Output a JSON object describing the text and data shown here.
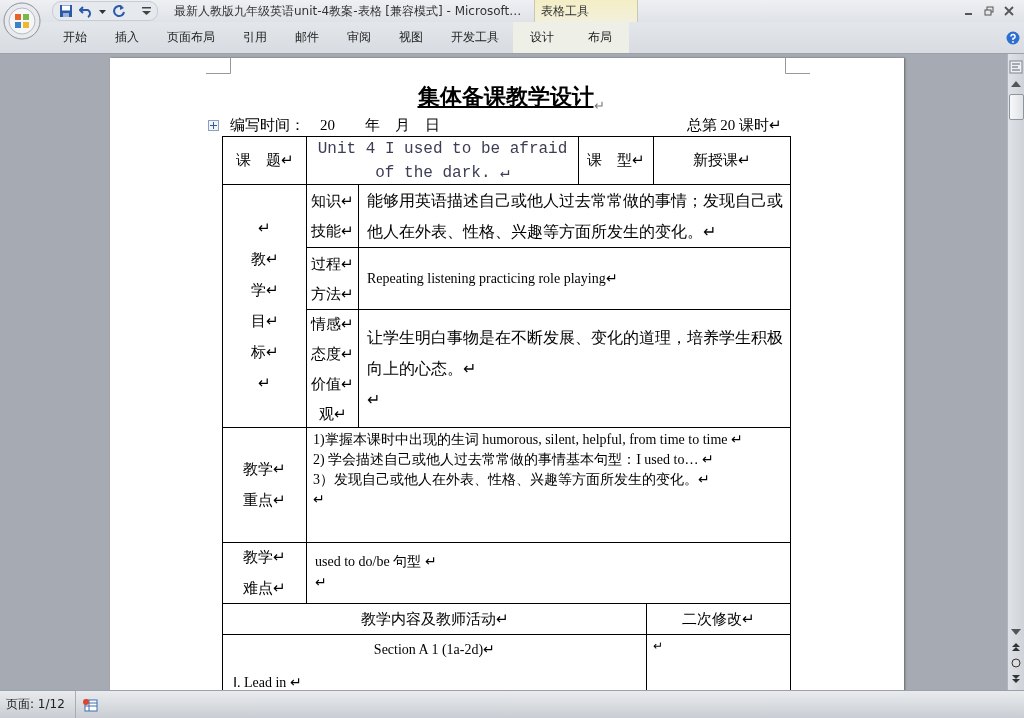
{
  "window": {
    "title": "最新人教版九年级英语unit-4教案-表格 [兼容模式] - Microsoft…",
    "context_group": "表格工具"
  },
  "ribbon_tabs": [
    {
      "label": "开始",
      "kind": "standard"
    },
    {
      "label": "插入",
      "kind": "standard"
    },
    {
      "label": "页面布局",
      "kind": "standard"
    },
    {
      "label": "引用",
      "kind": "standard"
    },
    {
      "label": "邮件",
      "kind": "standard"
    },
    {
      "label": "审阅",
      "kind": "standard"
    },
    {
      "label": "视图",
      "kind": "standard"
    },
    {
      "label": "开发工具",
      "kind": "standard"
    },
    {
      "label": "设计",
      "kind": "contextual"
    },
    {
      "label": "布局",
      "kind": "contextual"
    }
  ],
  "document": {
    "title": "集体备课教学设计",
    "title_mark": "↵",
    "meta_left": "编写时间：　20　　年　月　日",
    "meta_right": "总第 20 课时↵",
    "table": {
      "topic_label": "课　题↵",
      "topic": "Unit 4 I used to be afraid of the dark. ↵",
      "type_label": "课　型↵",
      "type": "新授课↵",
      "goals_label": [
        "↵",
        "教↵",
        "学↵",
        "目↵",
        "标↵",
        "↵"
      ],
      "goals": [
        {
          "label": [
            "知识↵",
            "技能↵"
          ],
          "lines": [
            "能够用英语描述自己或他人过去常常做的事情；发现自己或他人在外表、性格、兴趣等方面所发生的变化。↵"
          ]
        },
        {
          "label": [
            "过程↵",
            "方法↵"
          ],
          "lines": [
            "Repeating listening practicing role playing↵"
          ]
        },
        {
          "label": [
            "情感↵",
            "态度↵",
            "价值↵",
            "观↵"
          ],
          "lines": [
            "让学生明白事物是在不断发展、变化的道理，培养学生积极向上的心态。↵",
            "↵"
          ]
        }
      ],
      "key_points": {
        "label": [
          "教学↵",
          "重点↵"
        ],
        "lines": [
          "1)掌握本课时中出现的生词 humorous, silent, helpful, from time to time ↵",
          "2) 学会描述自己或他人过去常常做的事情基本句型：I used to… ↵",
          "3）发现自己或他人在外表、性格、兴趣等方面所发生的变化。↵",
          "↵"
        ]
      },
      "difficulties": {
        "label": [
          "教学↵",
          "难点↵"
        ],
        "lines": [
          "used to do/be 句型 ↵",
          "↵"
        ]
      },
      "content_header": "教学内容及教师活动↵",
      "revision_header": "二次修改↵",
      "content": {
        "heading": "Section A 1 (1a-2d)↵",
        "lines": [
          "Ⅰ. Lead in ↵"
        ]
      },
      "revision": "↵"
    }
  },
  "status_bar": {
    "page": "页面: 1/12"
  }
}
